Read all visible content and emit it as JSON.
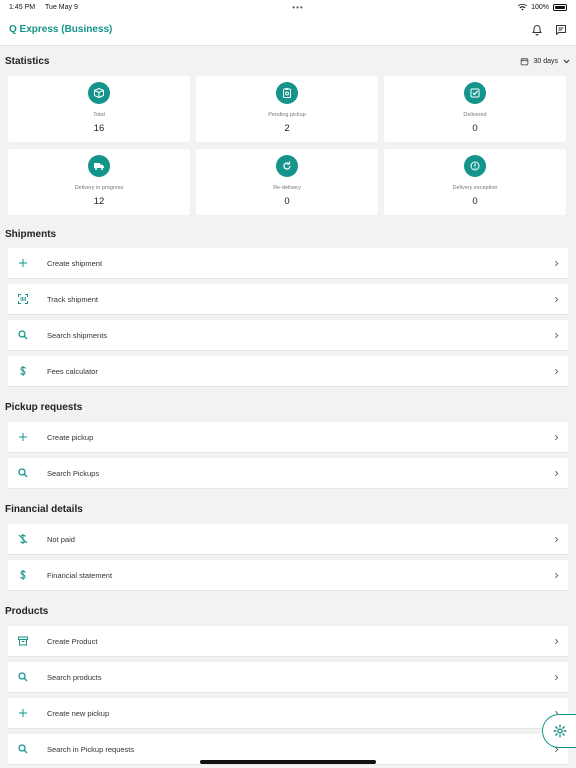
{
  "status_bar": {
    "time": "1:45 PM",
    "date": "Tue May 9",
    "battery": "100%"
  },
  "header": {
    "title": "Q Express (Business)"
  },
  "colors": {
    "accent": "#14948a",
    "background": "#f2f2f2"
  },
  "statistics": {
    "title": "Statistics",
    "range": "30 days",
    "cards": [
      {
        "icon": "box-icon",
        "label": "Total",
        "value": "16"
      },
      {
        "icon": "clipboard-icon",
        "label": "Pending pickup",
        "value": "2"
      },
      {
        "icon": "check-icon",
        "label": "Delivered",
        "value": "0"
      },
      {
        "icon": "truck-icon",
        "label": "Delivery in progress",
        "value": "12"
      },
      {
        "icon": "refresh-icon",
        "label": "Re-delivery",
        "value": "0"
      },
      {
        "icon": "alert-icon",
        "label": "Delivery exception",
        "value": "0"
      }
    ]
  },
  "shipments": {
    "title": "Shipments",
    "items": [
      {
        "icon": "plus-icon",
        "label": "Create shipment"
      },
      {
        "icon": "barcode-scan-icon",
        "label": "Track shipment"
      },
      {
        "icon": "search-icon",
        "label": "Search shipments"
      },
      {
        "icon": "dollar-icon",
        "label": "Fees calculator"
      }
    ]
  },
  "pickup_requests": {
    "title": "Pickup requests",
    "items": [
      {
        "icon": "plus-icon",
        "label": "Create pickup"
      },
      {
        "icon": "search-icon",
        "label": "Search Pickups"
      }
    ]
  },
  "financial": {
    "title": "Financial details",
    "items": [
      {
        "icon": "money-off-icon",
        "label": "Not paid"
      },
      {
        "icon": "dollar-icon",
        "label": "Financial statement"
      }
    ]
  },
  "products": {
    "title": "Products",
    "items": [
      {
        "icon": "archive-icon",
        "label": "Create Product"
      },
      {
        "icon": "search-icon",
        "label": "Search products"
      },
      {
        "icon": "plus-icon",
        "label": "Create new pickup"
      },
      {
        "icon": "search-icon",
        "label": "Search in Pickup requests"
      }
    ]
  }
}
